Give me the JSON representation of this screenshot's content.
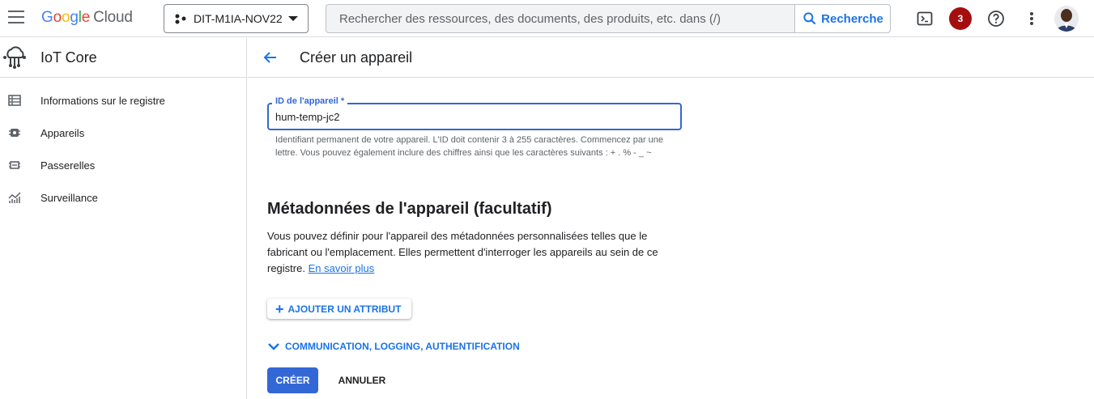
{
  "header": {
    "logo_letters": [
      "G",
      "o",
      "o",
      "g",
      "l",
      "e"
    ],
    "logo_suffix": "Cloud",
    "project_name": "DIT-M1IA-NOV22",
    "search_placeholder": "Rechercher des ressources, des documents, des produits, etc. dans (/)",
    "search_button": "Recherche",
    "notification_count": "3",
    "icons": [
      "menu-icon",
      "project-dots-icon",
      "chevron-down-icon",
      "search-icon",
      "terminal-icon",
      "help-icon",
      "more-vert-icon"
    ]
  },
  "sidebar": {
    "product_title": "IoT Core",
    "items": [
      {
        "label": "Informations sur le registre",
        "icon": "table-icon"
      },
      {
        "label": "Appareils",
        "icon": "chip-icon"
      },
      {
        "label": "Passerelles",
        "icon": "gateway-icon"
      },
      {
        "label": "Surveillance",
        "icon": "monitoring-icon"
      }
    ]
  },
  "main": {
    "title": "Créer un appareil",
    "device_id": {
      "label": "ID de l'appareil *",
      "value": "hum-temp-jc2",
      "hint": "Identifiant permanent de votre appareil. L'ID doit contenir 3 à 255 caractères. Commencez par une lettre. Vous pouvez également inclure des chiffres ainsi que les caractères suivants : + . % - _ ~"
    },
    "metadata": {
      "title": "Métadonnées de l'appareil (facultatif)",
      "description": "Vous pouvez définir pour l'appareil des métadonnées personnalisées telles que le fabricant ou l'emplacement. Elles permettent d'interroger les appareils au sein de ce registre.",
      "link": "En savoir plus",
      "add_button": "AJOUTER UN ATTRIBUT"
    },
    "expand_section": "COMMUNICATION, LOGGING, AUTHENTIFICATION",
    "create_button": "CRÉER",
    "cancel_button": "ANNULER"
  },
  "colors": {
    "primary": "#1a73e8",
    "field_focus": "#3367d6",
    "badge": "#a50e0e"
  }
}
